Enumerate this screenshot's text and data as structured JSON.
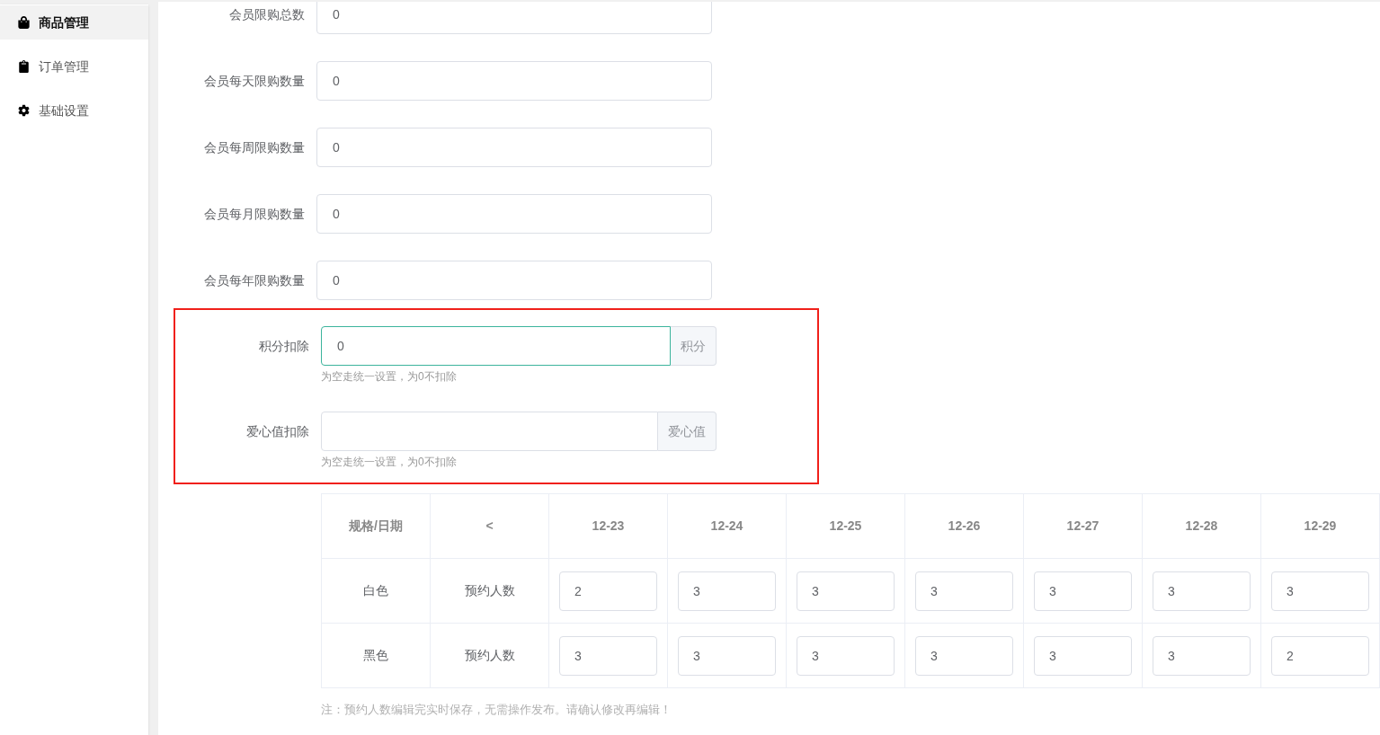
{
  "sidebar": {
    "items": [
      {
        "label": "商品管理",
        "selected": true
      },
      {
        "label": "订单管理",
        "selected": false
      },
      {
        "label": "基础设置",
        "selected": false
      }
    ]
  },
  "form": {
    "fields": [
      {
        "label": "会员限购总数",
        "value": "0"
      },
      {
        "label": "会员每天限购数量",
        "value": "0"
      },
      {
        "label": "会员每周限购数量",
        "value": "0"
      },
      {
        "label": "会员每月限购数量",
        "value": "0"
      },
      {
        "label": "会员每年限购数量",
        "value": "0"
      }
    ],
    "highlighted_fields": [
      {
        "label": "积分扣除",
        "value": "0",
        "addon": "积分",
        "hint": "为空走统一设置，为0不扣除",
        "focused": true
      },
      {
        "label": "爱心值扣除",
        "addon": "爱心值",
        "hint": "为空走统一设置，为0不扣除",
        "focused": false
      }
    ]
  },
  "table": {
    "columns": [
      "规格/日期",
      "<",
      "12-23",
      "12-24",
      "12-25",
      "12-26",
      "12-27",
      "12-28",
      "12-29"
    ],
    "rows": [
      {
        "spec": "白色",
        "type": "预约人数",
        "values": [
          "2",
          "3",
          "3",
          "3",
          "3",
          "3",
          "3"
        ]
      },
      {
        "spec": "黑色",
        "type": "预约人数",
        "values": [
          "3",
          "3",
          "3",
          "3",
          "3",
          "3",
          "2"
        ]
      }
    ],
    "note": "注：预约人数编辑完实时保存，无需操作发布。请确认修改再编辑！"
  }
}
